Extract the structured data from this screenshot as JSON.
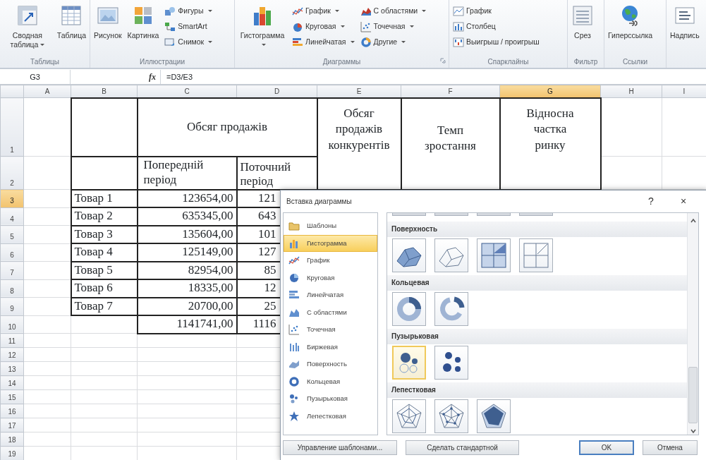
{
  "ribbon": {
    "groups": [
      {
        "label": "Таблицы",
        "buttons": [
          {
            "kind": "large",
            "label": "Сводная таблица",
            "dropdown": true
          },
          {
            "kind": "large",
            "label": "Таблица",
            "dropdown": false
          }
        ]
      },
      {
        "label": "Иллюстрации",
        "buttons": [
          {
            "kind": "large",
            "label": "Рисунок",
            "dropdown": false
          },
          {
            "kind": "large",
            "label": "Картинка",
            "dropdown": false
          },
          {
            "kind": "small",
            "label": "Фигуры",
            "dropdown": true
          },
          {
            "kind": "small",
            "label": "SmartArt",
            "dropdown": false
          },
          {
            "kind": "small",
            "label": "Снимок",
            "dropdown": true
          }
        ]
      },
      {
        "label": "Диаграммы",
        "launcher": true,
        "buttons": [
          {
            "kind": "large",
            "label": "Гистограмма",
            "dropdown": true
          },
          {
            "kind": "small",
            "label": "График",
            "dropdown": true
          },
          {
            "kind": "small",
            "label": "Круговая",
            "dropdown": true
          },
          {
            "kind": "small",
            "label": "Линейчатая",
            "dropdown": true
          },
          {
            "kind": "small",
            "label": "С областями",
            "dropdown": true
          },
          {
            "kind": "small",
            "label": "Точечная",
            "dropdown": true
          },
          {
            "kind": "small",
            "label": "Другие",
            "dropdown": true
          }
        ]
      },
      {
        "label": "Спарклайны",
        "buttons": [
          {
            "kind": "small",
            "label": "График",
            "dropdown": false
          },
          {
            "kind": "small",
            "label": "Столбец",
            "dropdown": false
          },
          {
            "kind": "small",
            "label": "Выигрыш / проигрыш",
            "dropdown": false
          }
        ]
      },
      {
        "label": "Фильтр",
        "buttons": [
          {
            "kind": "large",
            "label": "Срез",
            "dropdown": false
          }
        ]
      },
      {
        "label": "Ссылки",
        "buttons": [
          {
            "kind": "large",
            "label": "Гиперссылка",
            "dropdown": false
          }
        ]
      },
      {
        "buttons": [
          {
            "kind": "large",
            "label": "Надпись",
            "dropdown": false
          }
        ]
      }
    ]
  },
  "formula_bar": {
    "name_box": "G3",
    "function_button": "fx",
    "formula": "=D3/E3"
  },
  "sheet": {
    "columns": [
      {
        "label": "A",
        "selected": false
      },
      {
        "label": "B",
        "selected": false
      },
      {
        "label": "C",
        "selected": false
      },
      {
        "label": "D",
        "selected": false
      },
      {
        "label": "E",
        "selected": false
      },
      {
        "label": "F",
        "selected": false
      },
      {
        "label": "G",
        "selected": true
      },
      {
        "label": "H",
        "selected": false
      },
      {
        "label": "I",
        "selected": false
      }
    ],
    "rows": [
      {
        "label": "1",
        "selected": false
      },
      {
        "label": "2",
        "selected": false
      },
      {
        "label": "3",
        "selected": true
      },
      {
        "label": "4",
        "selected": false
      },
      {
        "label": "5",
        "selected": false
      },
      {
        "label": "6",
        "selected": false
      },
      {
        "label": "7",
        "selected": false
      },
      {
        "label": "8",
        "selected": false
      },
      {
        "label": "9",
        "selected": false
      },
      {
        "label": "10",
        "selected": false
      },
      {
        "label": "11",
        "selected": false
      },
      {
        "label": "12",
        "selected": false
      },
      {
        "label": "13",
        "selected": false
      },
      {
        "label": "14",
        "selected": false
      },
      {
        "label": "15",
        "selected": false
      },
      {
        "label": "16",
        "selected": false
      },
      {
        "label": "17",
        "selected": false
      },
      {
        "label": "18",
        "selected": false
      },
      {
        "label": "19",
        "selected": false
      }
    ],
    "headers": {
      "sales_volume": "Обсяг продажів",
      "previous_period": "Попередній період",
      "current_period": "Поточний період",
      "competitor_sales": "Обсяг продажів конкурентів",
      "growth_rate": "Темп зростання",
      "market_share": "Відносна частка ринку"
    },
    "products": [
      {
        "name": "Товар 1",
        "previous_period": "123654,00",
        "current_period": "121"
      },
      {
        "name": "Товар 2",
        "previous_period": "635345,00",
        "current_period": "643"
      },
      {
        "name": "Товар 3",
        "previous_period": "135604,00",
        "current_period": "101"
      },
      {
        "name": "Товар 4",
        "previous_period": "125149,00",
        "current_period": "127"
      },
      {
        "name": "Товар 5",
        "previous_period": "82954,00",
        "current_period": "85"
      },
      {
        "name": "Товар 6",
        "previous_period": "18335,00",
        "current_period": "12"
      },
      {
        "name": "Товар 7",
        "previous_period": "20700,00",
        "current_period": "25"
      }
    ],
    "totals": {
      "previous_period": "1141741,00",
      "current_period": "1116"
    }
  },
  "dialog": {
    "title": "Вставка диаграммы",
    "help": "?",
    "close": "×",
    "chart_types": [
      {
        "label": "Шаблоны",
        "selected": false
      },
      {
        "label": "Гистограмма",
        "selected": true
      },
      {
        "label": "График",
        "selected": false
      },
      {
        "label": "Круговая",
        "selected": false
      },
      {
        "label": "Линейчатая",
        "selected": false
      },
      {
        "label": "С областями",
        "selected": false
      },
      {
        "label": "Точечная",
        "selected": false
      },
      {
        "label": "Биржевая",
        "selected": false
      },
      {
        "label": "Поверхность",
        "selected": false
      },
      {
        "label": "Кольцевая",
        "selected": false
      },
      {
        "label": "Пузырьковая",
        "selected": false
      },
      {
        "label": "Лепестковая",
        "selected": false
      }
    ],
    "sections": [
      {
        "title": "Поверхность",
        "thumbnails": [
          {
            "selected": false
          },
          {
            "selected": false
          },
          {
            "selected": false
          },
          {
            "selected": false
          }
        ]
      },
      {
        "title": "Кольцевая",
        "thumbnails": [
          {
            "selected": false
          },
          {
            "selected": false
          }
        ]
      },
      {
        "title": "Пузырьковая",
        "thumbnails": [
          {
            "selected": true
          },
          {
            "selected": false
          }
        ]
      },
      {
        "title": "Лепестковая",
        "thumbnails": [
          {
            "selected": false
          },
          {
            "selected": false
          },
          {
            "selected": false
          }
        ]
      }
    ],
    "buttons": [
      {
        "label": "Управление шаблонами...",
        "default": false
      },
      {
        "label": "Сделать стандартной",
        "default": false
      },
      {
        "label": "OK",
        "default": true
      },
      {
        "label": "Отмена",
        "default": false
      }
    ]
  }
}
